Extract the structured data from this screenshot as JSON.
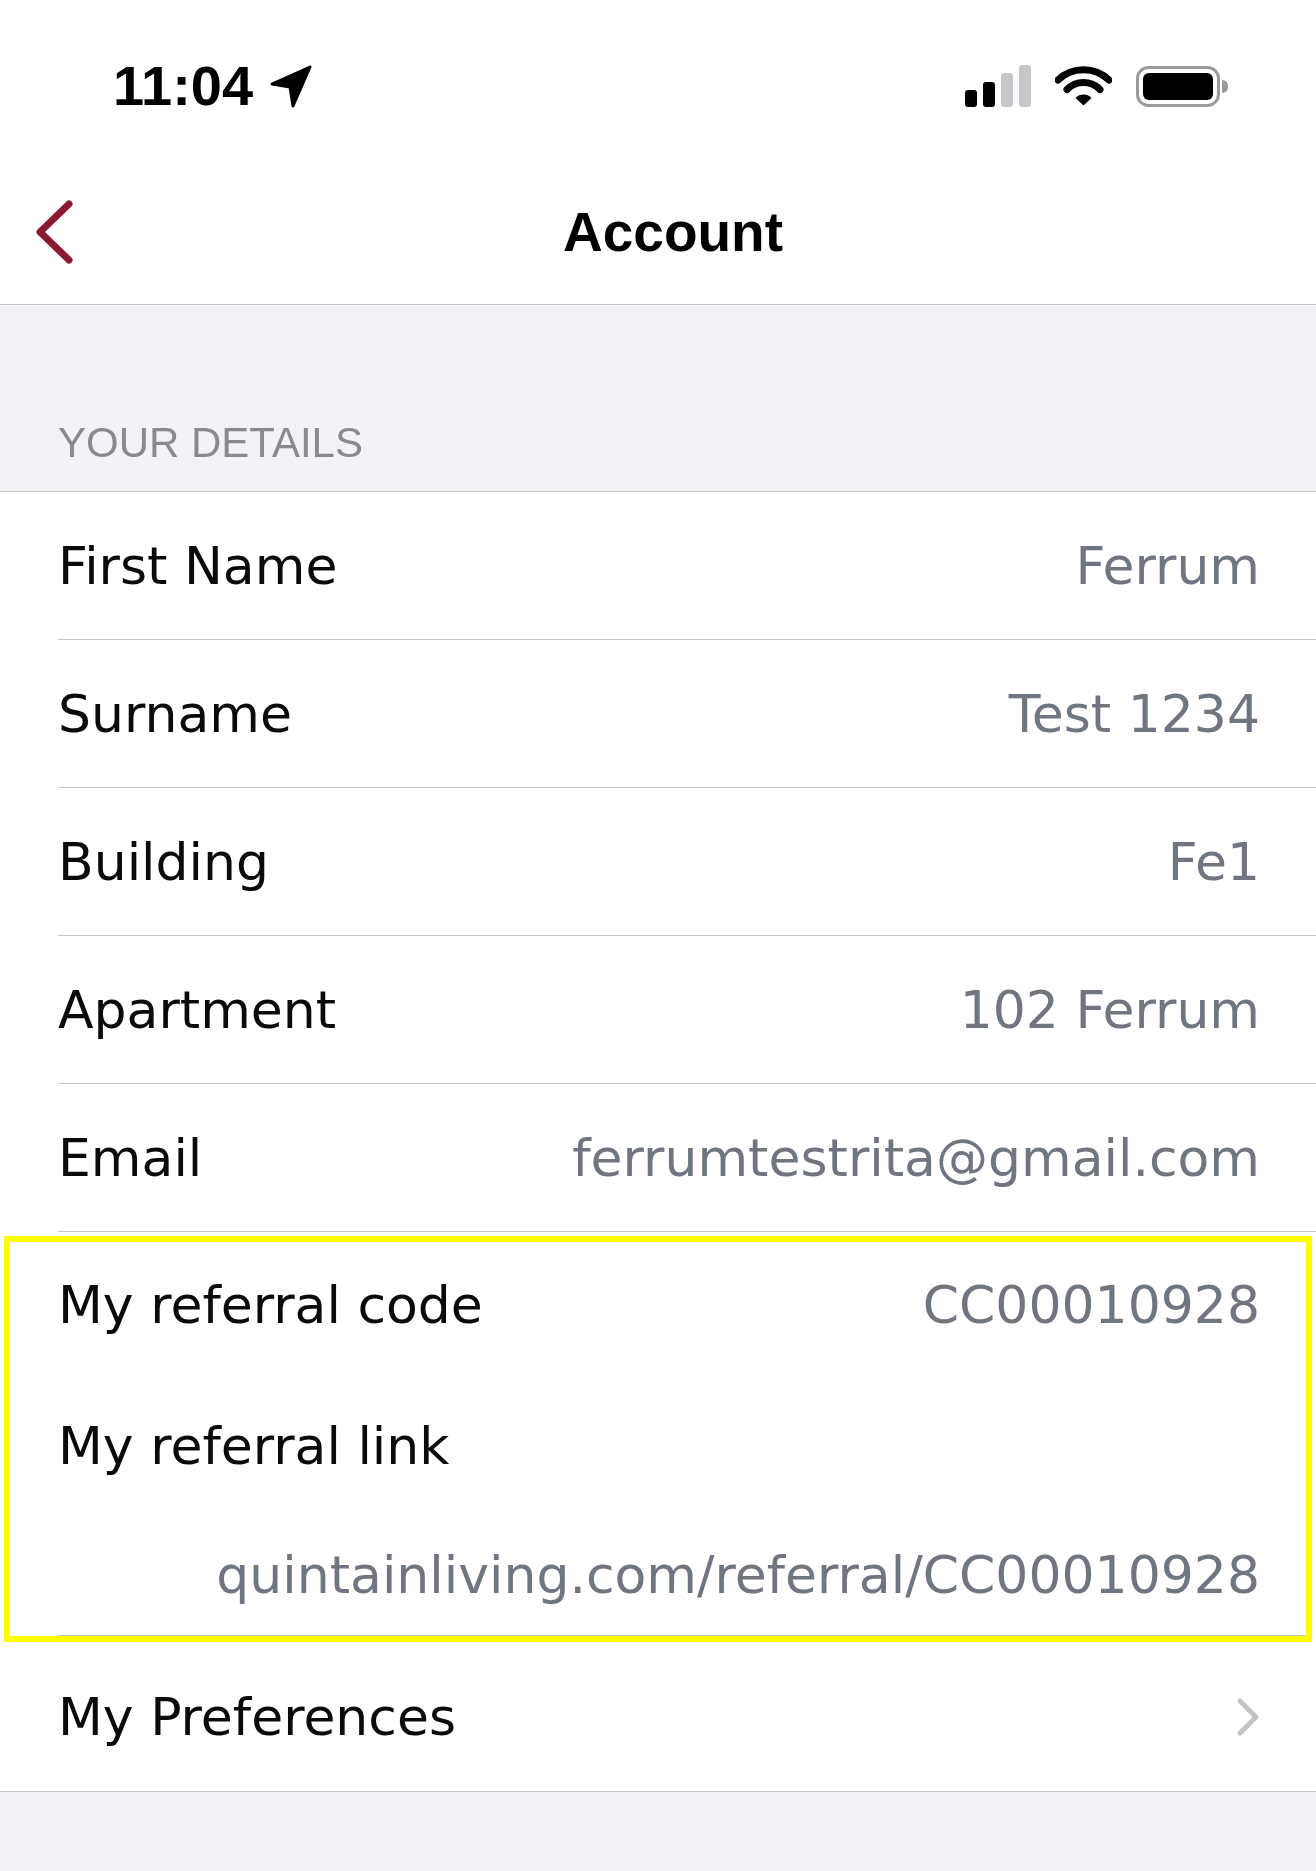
{
  "status_bar": {
    "time": "11:04"
  },
  "nav_bar": {
    "title": "Account"
  },
  "section": {
    "header": "YOUR DETAILS",
    "cells": [
      {
        "highlighted": false,
        "lines": [
          {
            "kind": "pair",
            "label": "First Name",
            "value": "Ferrum"
          }
        ]
      },
      {
        "highlighted": false,
        "lines": [
          {
            "kind": "pair",
            "label": "Surname",
            "value": "Test 1234"
          }
        ]
      },
      {
        "highlighted": false,
        "lines": [
          {
            "kind": "pair",
            "label": "Building",
            "value": "Fe1"
          }
        ]
      },
      {
        "highlighted": false,
        "lines": [
          {
            "kind": "pair",
            "label": "Apartment",
            "value": "102 Ferrum"
          }
        ]
      },
      {
        "highlighted": false,
        "lines": [
          {
            "kind": "pair",
            "label": "Email",
            "value": "ferrumtestrita@gmail.com"
          }
        ]
      },
      {
        "highlighted": true,
        "lines": [
          {
            "kind": "pair",
            "label": "My referral code",
            "value": "CC00010928"
          },
          {
            "kind": "stacked",
            "label": "My referral link",
            "value": "quintainliving.com/referral/CC00010928"
          }
        ]
      },
      {
        "highlighted": false,
        "lines": [
          {
            "kind": "link",
            "label": "My Preferences"
          }
        ]
      }
    ]
  }
}
